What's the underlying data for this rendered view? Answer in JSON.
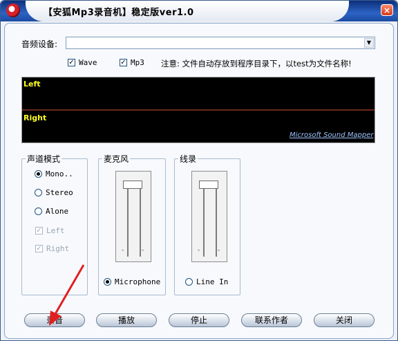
{
  "window": {
    "title": "【安狐Mp3录音机】稳定版ver1.0",
    "close_glyph": "×"
  },
  "device": {
    "label": "音频设备:",
    "value": ""
  },
  "options": {
    "wave_label": "Wave",
    "mp3_label": "Mp3",
    "notice": "注意: 文件自动存放到程序目录下，以test为文件名称!"
  },
  "meter": {
    "left_label": "Left",
    "right_label": "Right",
    "device_name": "Microsoft Sound Mapper"
  },
  "channel_mode": {
    "title": "声道模式",
    "mono": "Mono..",
    "stereo": "Stereo",
    "alone": "Alone",
    "left": "Left",
    "right": "Right"
  },
  "mic": {
    "title": "麦克风",
    "radio_label": "Microphone"
  },
  "line": {
    "title": "线录",
    "radio_label": "Line In"
  },
  "buttons": {
    "record": "录音",
    "play": "播放",
    "stop": "停止",
    "contact": "联系作者",
    "close": "关闭"
  },
  "colors": {
    "meter_label": "#ffff22",
    "meter_bg": "#000000",
    "title_bar": "#2d63c4",
    "annotation_arrow": "#e02020"
  }
}
